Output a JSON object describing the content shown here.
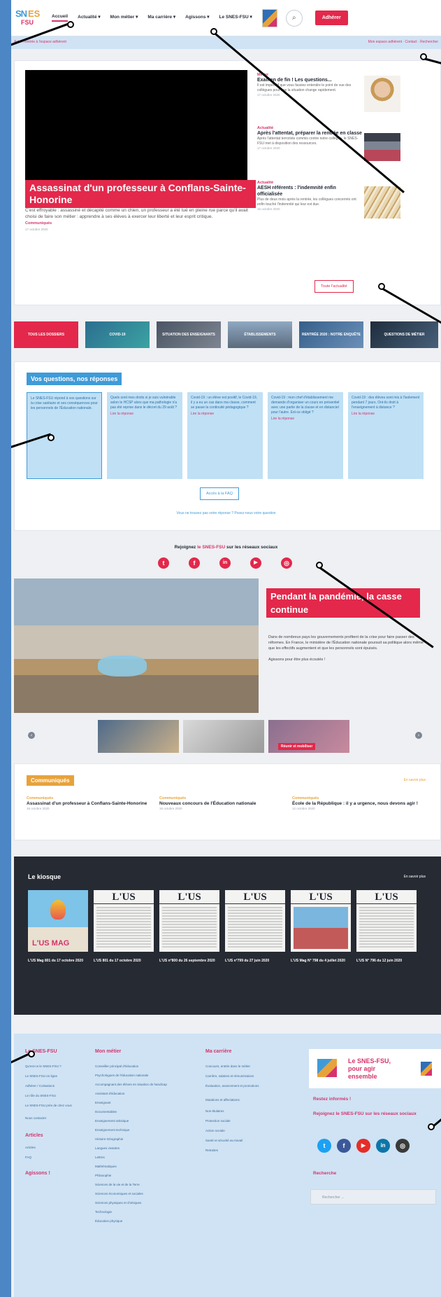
{
  "nav": {
    "logo_line1": "SN",
    "logo_line2": "ES",
    "logo_line3": "FSU",
    "items": [
      "Accueil",
      "Actualité ▾",
      "Mon métier ▾",
      "Ma carrière ▾",
      "Agissons ▾",
      "Le SNES-FSU ▾"
    ],
    "search_icon": "search-icon",
    "join_label": "Adhérer"
  },
  "subbar": {
    "left": "Actu : rentrée à l'espace adhérent",
    "right": "Mon espace adhérent · Contact · Rechercher"
  },
  "hero": {
    "title": "Assassinat d'un professeur à Conflans-Sainte-Honorine",
    "desc": "C'est effroyable : assassiné et décapité comme un chien, un professeur a été tué en pleine rue parce qu'il avait choisi de faire son métier : apprendre à ses élèves à exercer leur liberté et leur esprit critique.",
    "tag": "Communiqués",
    "date": "17 octobre 2020"
  },
  "side_articles": [
    {
      "tag": "Métier",
      "title": "Examen de fin ! Les questions...",
      "desc": "Il est impératif que vous fassiez entendre le point de vue des collègues pour que la situation change rapidement.",
      "date": "17 octobre 2020"
    },
    {
      "tag": "Actualité",
      "title": "Après l'attentat, préparer la rentrée en classe",
      "desc": "Après l'attentat terroriste commis contre notre collègue, le SNES-FSU met à disposition des ressources.",
      "date": "17 octobre 2020"
    },
    {
      "tag": "Actualité",
      "title": "AESH référents : l'indemnité enfin officialisée",
      "desc": "Plus de deux mois après la rentrée, les collègues concernés ont enfin touché l'indemnité qui leur est due.",
      "date": "16 octobre 2020"
    }
  ],
  "news_button": "Toute l'actualité",
  "tiles": [
    {
      "label": "TOUS LES DOSSIERS"
    },
    {
      "label": "COVID-19"
    },
    {
      "label": "SITUATION DES ENSEIGNANTS"
    },
    {
      "label": "ÉTABLISSEMENTS"
    },
    {
      "label": "RENTRÉE 2020 : NOTRE ENQUÊTE"
    },
    {
      "label": "QUESTIONS DE MÉTIER"
    }
  ],
  "faq": {
    "heading": "Vos questions, nos réponses",
    "cards": [
      {
        "text": "Le SNES-FSU répond à vos questions sur la crise sanitaire et ses conséquences pour les personnels de l'Éducation nationale.",
        "more": "Lire"
      },
      {
        "text": "Quels sont mes droits si je suis vulnérable selon le HCSP alors que ma pathologie n'a pas été reprise dans le décret du 29 août ?",
        "more": "Lire la réponse"
      },
      {
        "text": "Covid-19 : un élève est positif, le Covid-19, il y a eu un cas dans ma classe, comment se passe la continuité pédagogique ?",
        "more": "Lire la réponse"
      },
      {
        "text": "Covid-19 : mon chef d'établissement me demande d'organiser un cours en présentiel avec une partie de la classe et en distanciel pour l'autre. Est-ce obligé ?",
        "more": "Lire la réponse"
      },
      {
        "text": "Covid-19 : des élèves sont mis à l'isolement pendant 7 jours. Ont-ils droit à l'enseignement à distance ?",
        "more": "Lire la réponse"
      }
    ],
    "button": "Accès à la FAQ",
    "footer": "Vous ne trouvez pas votre réponse ? Posez-nous votre question"
  },
  "social": {
    "text_before": "Rejoignez",
    "text_brand": "le SNES-FSU",
    "text_after": "sur les réseaux sociaux",
    "icons": [
      {
        "name": "twitter-icon",
        "glyph": "t",
        "color": "#e3284b"
      },
      {
        "name": "facebook-icon",
        "glyph": "f",
        "color": "#e3284b"
      },
      {
        "name": "linkedin-icon",
        "glyph": "in",
        "color": "#e3284b"
      },
      {
        "name": "youtube-icon",
        "glyph": "▶",
        "color": "#e3284b"
      },
      {
        "name": "instagram-icon",
        "glyph": "◎",
        "color": "#e3284b"
      }
    ]
  },
  "feature": {
    "title": "Pendant la pandémie, la casse continue",
    "desc": "Dans de nombreux pays les gouvernements profitent de la crise pour faire passer des réformes. En France, le ministère de l'Éducation nationale poursuit sa politique alors même que les effectifs augmentent et que les personnels sont épuisés.",
    "desc2": "Agissons pour être plus écoutés !",
    "slide_caption": "Réunir et mobiliser"
  },
  "communiques": {
    "heading": "Communiqués",
    "more": "En savoir plus",
    "items": [
      {
        "cat": "Communiqués",
        "title": "Assassinat d'un professeur à Conflans-Sainte-Honorine",
        "date": "16 octobre 2020"
      },
      {
        "cat": "Communiqués",
        "title": "Nouveaux concours de l'Éducation nationale",
        "date": "16 octobre 2020"
      },
      {
        "cat": "Communiqués",
        "title": "École de la République : il y a urgence, nous devons agir !",
        "date": "12 octobre 2020"
      }
    ]
  },
  "kiosque": {
    "heading": "Le kiosque",
    "more": "En savoir plus",
    "mags": [
      {
        "cap": "L'US Mag 801 du 17 octobre 2020",
        "title": "L'US MAG"
      },
      {
        "cap": "L'US 801 du 17 octobre 2020",
        "title": "L'US"
      },
      {
        "cap": "L'US n°800 du 26 septembre 2020",
        "title": "L'US"
      },
      {
        "cap": "L'US n°799 du 27 juin 2020",
        "title": "L'US"
      },
      {
        "cap": "L'US Mag N° 798 du 4 juillet 2020",
        "title": "L'US"
      },
      {
        "cap": "L'US N° 796 du 12 juin 2020",
        "title": "L'US"
      }
    ]
  },
  "footer": {
    "col1_head": "Le SNES-FSU",
    "col1": [
      "Qu'est-ce le SNES-FSU ?",
      "Le SNES-FSU en ligne",
      "Adhérer / Cotisations",
      "Le rôle du SNES-FSU",
      "Le SNES-FSU près de chez vous",
      "Nous contacter"
    ],
    "col1b_head": "Articles",
    "col1b": [
      "Articles",
      "FAQ"
    ],
    "col1c_head": "Agissons !",
    "col2_head": "Mon métier",
    "col2": [
      "Conseiller principal d'éducation",
      "Psychologues de l'éducation nationale",
      "Accompagnant des élèves en situation de handicap",
      "Assistant d'éducation",
      "Enseignant",
      "Documentaliste",
      "Enseignement artistique",
      "Enseignement technique",
      "Histoire-Géographie",
      "Langues vivantes",
      "Lettres",
      "Mathématiques",
      "Philosophie",
      "Sciences de la vie et de la Terre",
      "Sciences économiques et sociales",
      "Sciences physiques et chimiques",
      "Technologie",
      "Éducation physique"
    ],
    "col3_head": "Ma carrière",
    "col3": [
      "Concours, entrée dans le métier",
      "Carrière, salaires et rémunérations",
      "Évaluation, avancement et promotions",
      "Mutations et affectations",
      "Non-titulaires",
      "Protection sociale",
      "Action sociale",
      "Santé et sécurité au travail",
      "Retraites"
    ],
    "box": "Le SNES-FSU, pour agir ensemble",
    "b1": "Restez informés !",
    "b2": "Rejoignez le SNES-FSU sur les réseaux sociaux",
    "b3": "Recherche",
    "search_placeholder": "Rechercher ...",
    "socials": [
      {
        "name": "twitter-icon",
        "glyph": "t",
        "color": "#1da1f2"
      },
      {
        "name": "facebook-icon",
        "glyph": "f",
        "color": "#3b5998"
      },
      {
        "name": "youtube-icon",
        "glyph": "▶",
        "color": "#e52d27"
      },
      {
        "name": "linkedin-icon",
        "glyph": "in",
        "color": "#0e76a8"
      },
      {
        "name": "instagram-icon",
        "glyph": "◎",
        "color": "#3a3a3a"
      }
    ]
  }
}
